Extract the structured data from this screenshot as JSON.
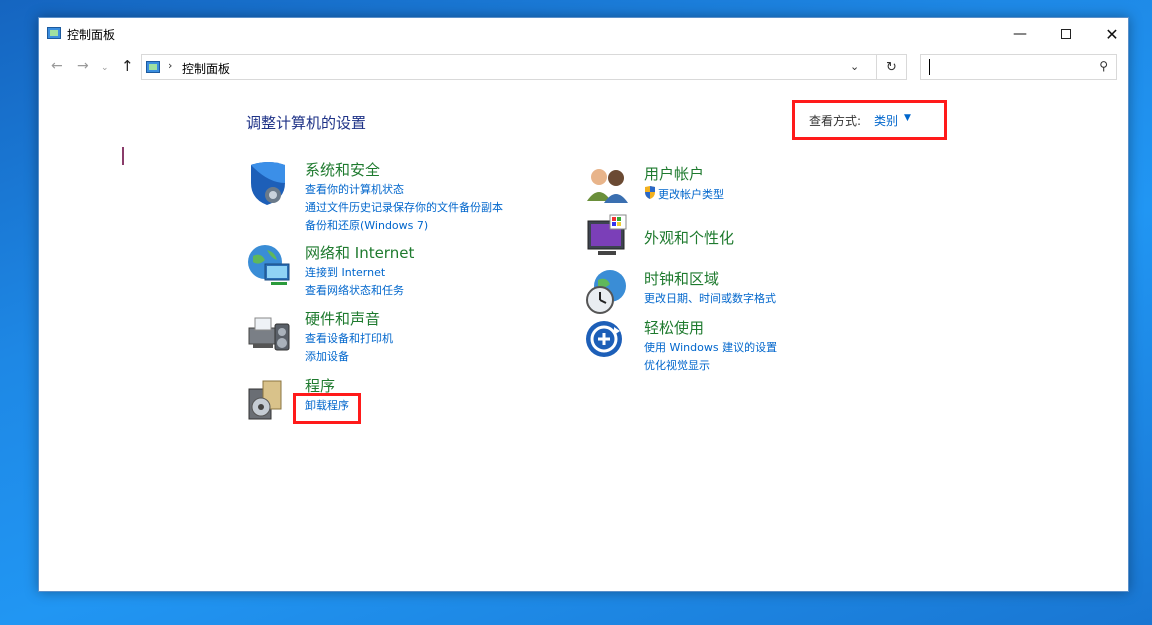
{
  "window": {
    "title": "控制面板",
    "min_glyph": "—",
    "close_glyph": "✕"
  },
  "nav": {
    "back_glyph": "←",
    "forward_glyph": "→",
    "recent_glyph": "⌄",
    "up_glyph": "↑"
  },
  "address": {
    "separator": "›",
    "path": "控制面板",
    "dropdown_glyph": "⌄",
    "refresh_glyph": "↻"
  },
  "search": {
    "placeholder": "",
    "icon_glyph": "⚲"
  },
  "main": {
    "heading": "调整计算机的设置",
    "view_by_label": "查看方式:",
    "view_by_value": "类别",
    "view_by_arrow": "▼"
  },
  "categories": {
    "security": {
      "title": "系统和安全",
      "links": [
        "查看你的计算机状态",
        "通过文件历史记录保存你的文件备份副本",
        "备份和还原(Windows 7)"
      ]
    },
    "network": {
      "title": "网络和 Internet",
      "links": [
        "连接到 Internet",
        "查看网络状态和任务"
      ]
    },
    "hardware": {
      "title": "硬件和声音",
      "links": [
        "查看设备和打印机",
        "添加设备"
      ]
    },
    "programs": {
      "title": "程序",
      "links": [
        "卸载程序"
      ]
    },
    "user_accounts": {
      "title": "用户帐户",
      "links": [
        "更改帐户类型"
      ]
    },
    "appearance": {
      "title": "外观和个性化",
      "links": []
    },
    "clock": {
      "title": "时钟和区域",
      "links": [
        "更改日期、时间或数字格式"
      ]
    },
    "ease": {
      "title": "轻松使用",
      "links": [
        "使用 Windows 建议的设置",
        "优化视觉显示"
      ]
    }
  },
  "colors": {
    "category_title": "#1e7a2e",
    "link": "#0066cc",
    "heading": "#1e3287",
    "highlight_box": "#ff1a1a"
  }
}
